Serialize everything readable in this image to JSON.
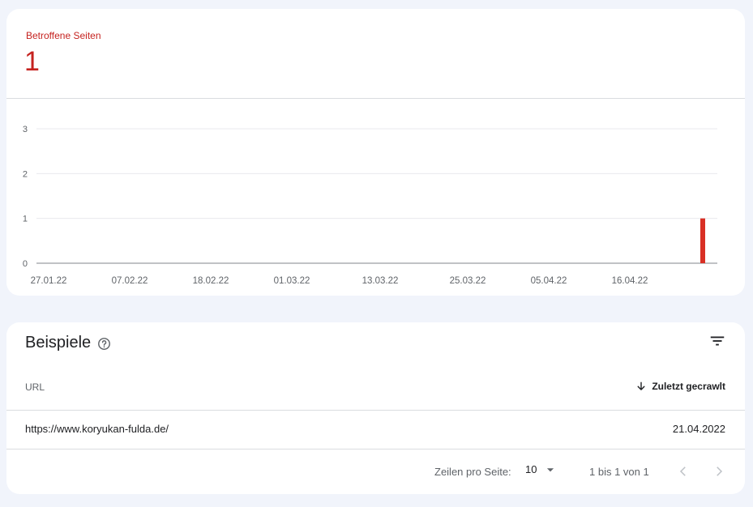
{
  "summary": {
    "label": "Betroffene Seiten",
    "value": "1",
    "accent": "#c5221f"
  },
  "chart_data": {
    "type": "bar",
    "x_tick_labels": [
      "27.01.22",
      "07.02.22",
      "18.02.22",
      "01.03.22",
      "13.03.22",
      "25.03.22",
      "05.04.22",
      "16.04.22"
    ],
    "y_tick_labels": [
      "0",
      "1",
      "2",
      "3"
    ],
    "ylim": [
      0,
      3
    ],
    "grid": true,
    "bars": [
      {
        "date": "21.04.22",
        "value": 1
      }
    ],
    "bar_color": "#d93025"
  },
  "examples": {
    "title": "Beispiele",
    "help_icon": "help-circle-icon",
    "filter_icon": "filter-list-icon",
    "columns": {
      "url": "URL",
      "last_crawled": "Zuletzt gecrawlt"
    },
    "sort_icon": "arrow-down-icon",
    "rows": [
      {
        "url": "https://www.koryukan-fulda.de/",
        "date": "21.04.2022"
      }
    ],
    "pagination": {
      "rows_per_page_label": "Zeilen pro Seite:",
      "rows_per_page_value": "10",
      "range": "1 bis 1 von 1"
    }
  }
}
